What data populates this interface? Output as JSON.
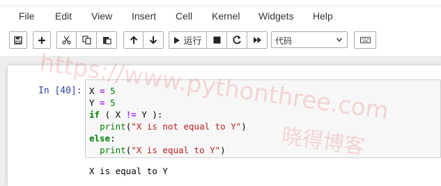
{
  "menu": [
    "File",
    "Edit",
    "View",
    "Insert",
    "Cell",
    "Kernel",
    "Widgets",
    "Help"
  ],
  "toolbar": {
    "run_label": "运行",
    "cell_type": "代码"
  },
  "cell": {
    "prompt": "In [40]:",
    "code": {
      "l1": {
        "var": "X",
        "eq": " = ",
        "val": "5"
      },
      "l2": {
        "var": "Y",
        "eq": " = ",
        "val": "5"
      },
      "l3": {
        "kw": "if",
        "p1": " ( X ",
        "op": "!=",
        "p2": " Y ):"
      },
      "l4": {
        "indent": "  ",
        "fn": "print",
        "open": "(",
        "str": "\"X is not equal to Y\"",
        "close": ")"
      },
      "l5": {
        "kw": "else",
        "colon": ":"
      },
      "l6": {
        "indent": "  ",
        "fn": "print",
        "open": "(",
        "str": "\"X is equal to Y\"",
        "close": ")"
      }
    },
    "output": "X is equal to Y"
  },
  "watermark": {
    "url": "https://www.pythonthree.com",
    "brand": "晓得博客"
  },
  "icons": [
    "save-icon",
    "plus-icon",
    "cut-icon",
    "copy-icon",
    "paste-icon",
    "arrow-up-icon",
    "arrow-down-icon",
    "play-icon",
    "stop-icon",
    "restart-icon",
    "fast-forward-icon",
    "keyboard-icon"
  ],
  "colors": {
    "prompt": "#303f9f",
    "keyword": "#008000",
    "string": "#ba2121",
    "operator": "#aa22ff"
  }
}
